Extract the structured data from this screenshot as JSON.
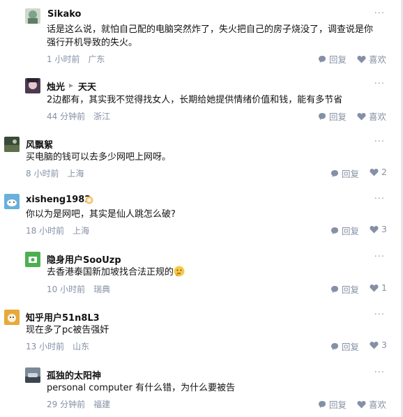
{
  "comments": [
    {
      "user": "Sikako",
      "reply_to": "",
      "line1": "话是这么说，就怕自己配的电脑突然炸了，失火把自己的房子烧没了，调查说是你",
      "line2": "强行开机导致的失火。",
      "time": "1 小时前",
      "location": "广东",
      "reply_label": "回复",
      "like_label": "喜欢"
    },
    {
      "user": "烛光",
      "reply_to": "天天",
      "line1": "2边都有，其实我不觉得找女人，长期给她提供情绪价值和钱，能有多节省",
      "line2": "",
      "time": "44 分钟前",
      "location": "浙江",
      "reply_label": "回复",
      "like_label": "喜欢"
    },
    {
      "user": "风飘絮",
      "reply_to": "",
      "line1": "买电脑的钱可以去多少网吧上网呀。",
      "line2": "",
      "time": "8 小时前",
      "location": "上海",
      "reply_label": "回复",
      "like_label": "2"
    },
    {
      "user": "xisheng1982",
      "reply_to": "",
      "line1": "你以为是网吧，其实是仙人跳怎么破?",
      "line2": "",
      "time": "18 小时前",
      "location": "上海",
      "reply_label": "回复",
      "like_label": "3"
    },
    {
      "user": "隐身用户SooUzp",
      "reply_to": "",
      "line1": "去香港泰国新加坡找合法正规的",
      "line2": "",
      "time": "10 小时前",
      "location": "瑞典",
      "reply_label": "回复",
      "like_label": "1"
    },
    {
      "user": "知乎用户51n8L3",
      "reply_to": "",
      "line1": "现在多了pc被告强奸",
      "line2": "",
      "time": "13 小时前",
      "location": "山东",
      "reply_label": "回复",
      "like_label": "3"
    },
    {
      "user": "孤独的太阳神",
      "reply_to": "",
      "line1": "personal computer 有什么错，为什么要被告",
      "line2": "",
      "time": "29 分钟前",
      "location": "福建",
      "reply_label": "回复",
      "like_label": "喜欢"
    }
  ],
  "more_glyph": "···",
  "emoji": "thinking-face-emoji",
  "colors": {
    "text": "#121212",
    "meta": "#8590a6",
    "icon": "#8590a6"
  }
}
